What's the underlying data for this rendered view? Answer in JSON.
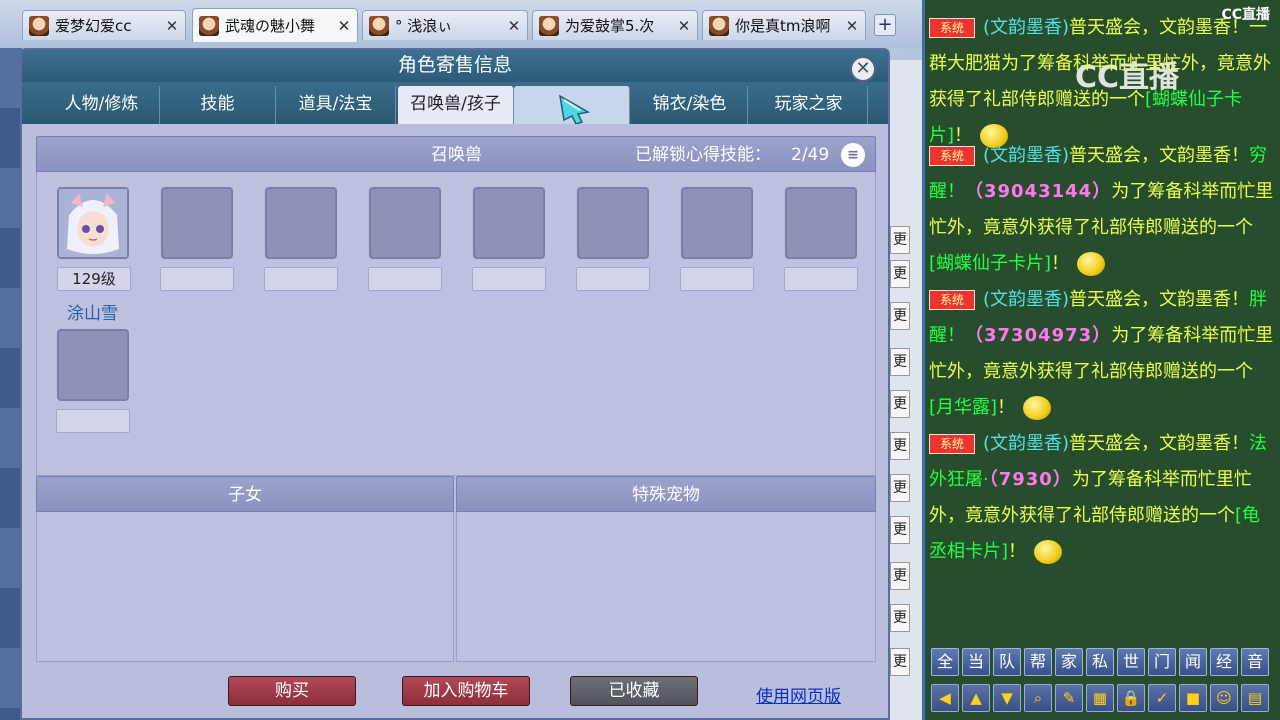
{
  "browser_tabs": [
    {
      "title": "爱梦幻爱cc",
      "active": false
    },
    {
      "title": "武魂の魅小舞",
      "active": true
    },
    {
      "title": "° 浅浪ぃ",
      "active": false
    },
    {
      "title": "为爱鼓掌5.次",
      "active": false
    },
    {
      "title": "你是真tm浪啊",
      "active": false
    }
  ],
  "close_glyph": "✕",
  "new_tab_glyph": "+",
  "dialog": {
    "title": "角色寄售信息",
    "close_glyph": "✕",
    "tabs": [
      "人物/修炼",
      "技能",
      "道具/法宝",
      "召唤兽/孩子",
      "",
      "锦衣/染色",
      "玩家之家"
    ],
    "active_tab": "召唤兽/孩子",
    "summon_section": {
      "title": "召唤兽",
      "unlock_label": "已解锁心得技能：",
      "unlock_value": "2/49",
      "menu_glyph": "≡",
      "pet": {
        "level": "129级",
        "name": "涂山雪"
      }
    },
    "children_section": {
      "title": "子女"
    },
    "special_pet_section": {
      "title": "特殊宠物"
    },
    "buttons": {
      "buy": "购买",
      "add_cart": "加入购物车",
      "collected": "已收藏",
      "web": "使用网页版"
    }
  },
  "right_edge_marks": [
    "更",
    "更",
    "更",
    "更",
    "更",
    "更",
    "更",
    "更",
    "更",
    "更",
    "更"
  ],
  "chat": {
    "brand": "CC直播",
    "watermark": "CC直播",
    "channel_tag": "系统",
    "messages": [
      {
        "prefix": "(文韵墨香)",
        "text": "普天盛会，文韵墨香！一群大肥猫为了筹备科举而忙里忙外，竟意外获得了礼部侍郎赠送的一个",
        "item": "[蝴蝶仙子卡片]",
        "end": "！"
      },
      {
        "prefix": "(文韵墨香)",
        "text": "普天盛会，文韵墨香！",
        "name": "穷醒！",
        "id": "（39043144）",
        "text2": "为了筹备科举而忙里忙外，竟意外获得了礼部侍郎赠送的一个",
        "item": "[蝴蝶仙子卡片]",
        "end": "！"
      },
      {
        "prefix": "(文韵墨香)",
        "text": "普天盛会，文韵墨香！",
        "name": "胖醒！",
        "id": "（37304973）",
        "text2": "为了筹备科举而忙里忙外，竟意外获得了礼部侍郎赠送的一个",
        "item": "[月华露]",
        "end": "！"
      },
      {
        "prefix": "(文韵墨香)",
        "text": "普天盛会，文韵墨香！",
        "name": "法外狂屠·",
        "id": "（7930）",
        "text2": "为了筹备科举而忙里忙外，竟意外获得了礼部侍郎赠送的一个",
        "item": "[龟丞相卡片]",
        "end": "！"
      }
    ],
    "channels": [
      "全",
      "当",
      "队",
      "帮",
      "家",
      "私",
      "世",
      "门",
      "闻",
      "经",
      "音"
    ],
    "tools": [
      "◀",
      "▲",
      "▼",
      "⌕",
      "✎",
      "▦",
      "🔒",
      "✓",
      "■",
      "☺",
      "▤"
    ]
  }
}
